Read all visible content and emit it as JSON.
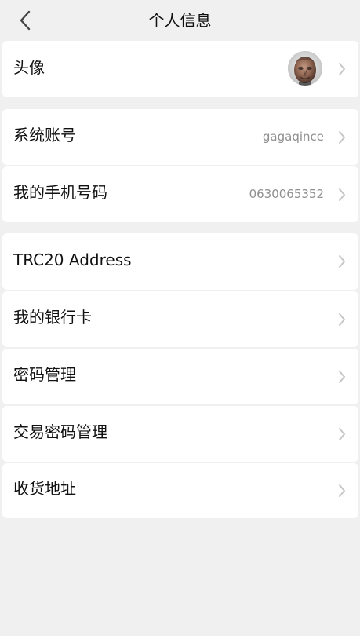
{
  "header": {
    "title": "个人信息"
  },
  "profile": {
    "avatar_label": "头像"
  },
  "account": {
    "system_account_label": "系统账号",
    "system_account_value": "gagaqince",
    "phone_label": "我的手机号码",
    "phone_value": "0630065352"
  },
  "settings": {
    "items": [
      {
        "label": "TRC20 Address"
      },
      {
        "label": "我的银行卡"
      },
      {
        "label": "密码管理"
      },
      {
        "label": "交易密码管理"
      },
      {
        "label": "收货地址"
      }
    ]
  },
  "icons": {
    "back": "chevron-left-icon",
    "row": "chevron-right-icon"
  },
  "colors": {
    "page_background": "#f0f0f0",
    "card_background": "#ffffff",
    "value_text": "#8f8f8f",
    "chevron": "#c7c7c7"
  }
}
